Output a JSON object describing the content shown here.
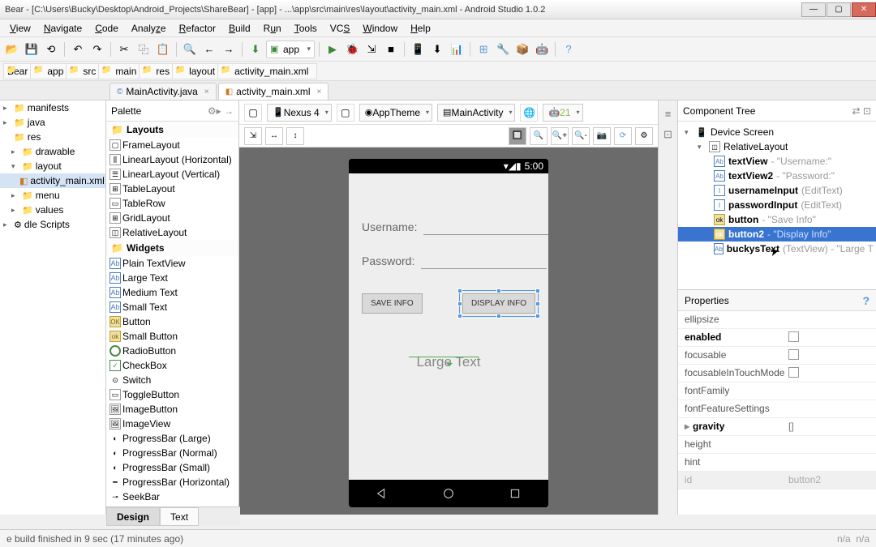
{
  "window": {
    "title": "Bear - [C:\\Users\\Bucky\\Desktop\\Android_Projects\\ShareBear] - [app] - ...\\app\\src\\main\\res\\layout\\activity_main.xml - Android Studio 1.0.2"
  },
  "menu": {
    "items": [
      "View",
      "Navigate",
      "Code",
      "Analyze",
      "Refactor",
      "Build",
      "Run",
      "Tools",
      "VCS",
      "Window",
      "Help"
    ]
  },
  "toolbar": {
    "run_config": "app"
  },
  "breadcrumb": {
    "items": [
      "Bear",
      "app",
      "src",
      "main",
      "res",
      "layout",
      "activity_main.xml"
    ]
  },
  "file_tabs": [
    {
      "label": "MainActivity.java",
      "active": false
    },
    {
      "label": "activity_main.xml",
      "active": true
    }
  ],
  "project_tree": [
    {
      "label": "manifests",
      "level": 1,
      "arrow": "▸"
    },
    {
      "label": "java",
      "level": 1,
      "arrow": "▸"
    },
    {
      "label": "res",
      "level": 1,
      "arrow": ""
    },
    {
      "label": "drawable",
      "level": 2,
      "arrow": "▸"
    },
    {
      "label": "layout",
      "level": 2,
      "arrow": "▾"
    },
    {
      "label": "activity_main.xml",
      "level": 3,
      "arrow": ""
    },
    {
      "label": "menu",
      "level": 2,
      "arrow": "▸"
    },
    {
      "label": "values",
      "level": 2,
      "arrow": "▸"
    },
    {
      "label": "dle Scripts",
      "level": 1,
      "arrow": "▸"
    }
  ],
  "palette": {
    "title": "Palette",
    "groups": [
      {
        "name": "Layouts",
        "items": [
          "FrameLayout",
          "LinearLayout (Horizontal)",
          "LinearLayout (Vertical)",
          "TableLayout",
          "TableRow",
          "GridLayout",
          "RelativeLayout"
        ]
      },
      {
        "name": "Widgets",
        "items": [
          "Plain TextView",
          "Large Text",
          "Medium Text",
          "Small Text",
          "Button",
          "Small Button",
          "RadioButton",
          "CheckBox",
          "Switch",
          "ToggleButton",
          "ImageButton",
          "ImageView",
          "ProgressBar (Large)",
          "ProgressBar (Normal)",
          "ProgressBar (Small)",
          "ProgressBar (Horizontal)",
          "SeekBar"
        ]
      }
    ]
  },
  "designer_toolbar": {
    "device": "Nexus 4",
    "theme": "AppTheme",
    "activity": "MainActivity",
    "api": "21"
  },
  "phone": {
    "time": "5:00",
    "username_label": "Username:",
    "password_label": "Password:",
    "save_btn": "SAVE INFO",
    "display_btn": "DISPLAY INFO",
    "large_text": "Large Text"
  },
  "component_tree": {
    "title": "Component Tree",
    "items": [
      {
        "name": "Device Screen",
        "desc": "",
        "level": 0,
        "icon": "dev"
      },
      {
        "name": "RelativeLayout",
        "desc": "",
        "level": 1,
        "icon": ""
      },
      {
        "name": "textView",
        "desc": " - \"Username:\"",
        "level": 2,
        "icon": "ab"
      },
      {
        "name": "textView2",
        "desc": " - \"Password:\"",
        "level": 2,
        "icon": "ab"
      },
      {
        "name": "usernameInput",
        "desc": " (EditText)",
        "level": 2,
        "icon": "ab"
      },
      {
        "name": "passwordInput",
        "desc": " (EditText)",
        "level": 2,
        "icon": "ab"
      },
      {
        "name": "button",
        "desc": " - \"Save Info\"",
        "level": 2,
        "icon": "ok"
      },
      {
        "name": "button2",
        "desc": " - \"Display Info\"",
        "level": 2,
        "icon": "ok",
        "selected": true
      },
      {
        "name": "buckysText",
        "desc": " (TextView) - \"Large T",
        "level": 2,
        "icon": "ab"
      }
    ]
  },
  "properties": {
    "title": "Properties",
    "rows": [
      {
        "name": "ellipsize",
        "val": "",
        "bold": false
      },
      {
        "name": "enabled",
        "val": "check",
        "bold": true
      },
      {
        "name": "focusable",
        "val": "check",
        "bold": false
      },
      {
        "name": "focusableInTouchMode",
        "val": "check",
        "bold": false
      },
      {
        "name": "fontFamily",
        "val": "",
        "bold": false
      },
      {
        "name": "fontFeatureSettings",
        "val": "",
        "bold": false
      },
      {
        "name": "gravity",
        "val": "[]",
        "bold": true,
        "expand": true
      },
      {
        "name": "height",
        "val": "",
        "bold": false
      },
      {
        "name": "hint",
        "val": "",
        "bold": false
      },
      {
        "name": "id",
        "val": "button2",
        "bold": false,
        "dim": true
      }
    ]
  },
  "design_tabs": {
    "design": "Design",
    "text": "Text"
  },
  "status": {
    "msg": "e build finished in 9 sec (17 minutes ago)",
    "na": "n/a"
  }
}
